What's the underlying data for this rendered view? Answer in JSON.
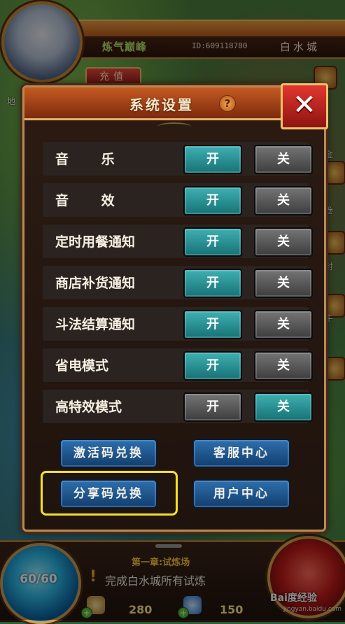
{
  "player": {
    "name": "炼气巅峰",
    "id": "ID:609118780",
    "city": "白水城"
  },
  "header": {
    "recharge_label": "充值"
  },
  "side_labels": {
    "left_top": "地",
    "right": [
      "金",
      "卷",
      "封",
      "牛"
    ]
  },
  "modal": {
    "title": "系统设置",
    "help_glyph": "?",
    "close_glyph": "✕",
    "rows": [
      {
        "label": "音 乐",
        "on_label": "开",
        "off_label": "关",
        "state": "on"
      },
      {
        "label": "音 效",
        "on_label": "开",
        "off_label": "关",
        "state": "on"
      },
      {
        "label": "定时用餐通知",
        "on_label": "开",
        "off_label": "关",
        "state": "on"
      },
      {
        "label": "商店补货通知",
        "on_label": "开",
        "off_label": "关",
        "state": "on"
      },
      {
        "label": "斗法结算通知",
        "on_label": "开",
        "off_label": "关",
        "state": "on"
      },
      {
        "label": "省电模式",
        "on_label": "开",
        "off_label": "关",
        "state": "on"
      },
      {
        "label": "高特效模式",
        "on_label": "开",
        "off_label": "关",
        "state": "off"
      }
    ],
    "actions": {
      "activate_code": "激活码兑换",
      "customer_service": "客服中心",
      "share_code": "分享码兑换",
      "user_center": "用户中心"
    }
  },
  "hud": {
    "energy": "60/60",
    "chapter": "第一章:试炼场",
    "quest": "完成白水城所有试炼",
    "quest_mark": "!",
    "gold": "280",
    "gems": "150",
    "plus": "+"
  },
  "watermark": {
    "brand": "Bai度经验",
    "url": "jingyan.baidu.com"
  },
  "colors": {
    "accent_on": "#3fb0b2",
    "inactive": "#5a5a5a",
    "highlight": "#f6e12a",
    "action_blue": "#2e6fae"
  }
}
